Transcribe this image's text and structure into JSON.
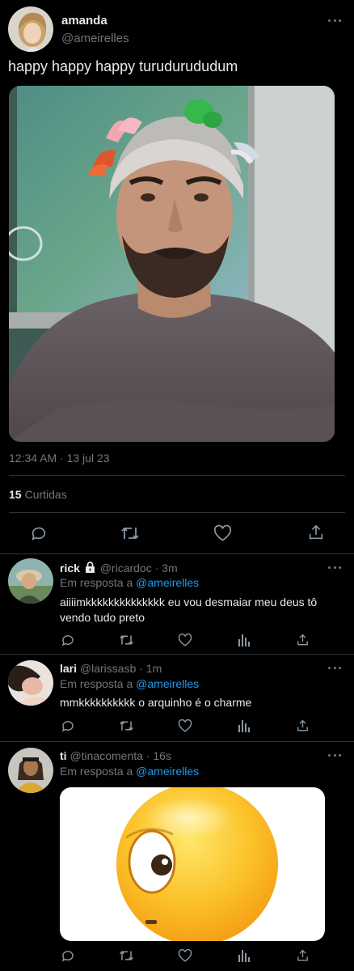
{
  "tweet": {
    "display_name": "amanda",
    "handle": "@ameirelles",
    "text": "happy happy happy turudurududum",
    "photo": "man-with-headband-photo",
    "timestamp": "12:34 AM · 13 jul 23",
    "likes_count": "15",
    "likes_label": "Curtidas"
  },
  "replies": [
    {
      "display_name": "rick",
      "locked": true,
      "handle": "@ricardoc",
      "time": "· 3m",
      "in_reply_prefix": "Em resposta a",
      "in_reply_to": "@ameirelles",
      "text": "aiiiimkkkkkkkkkkkkkk eu vou desmaiar meu deus tô vendo tudo preto"
    },
    {
      "display_name": "lari",
      "handle": "@larissasb",
      "time": "· 1m",
      "in_reply_prefix": "Em resposta a",
      "in_reply_to": "@ameirelles",
      "text": "mmkkkkkkkkkk o arquinho é o charme"
    },
    {
      "display_name": "ti",
      "handle": "@tinacomenta",
      "time": "· 16s",
      "in_reply_prefix": "Em resposta a",
      "in_reply_to": "@ameirelles",
      "media": "face-with-rolling-eye-emoji"
    }
  ],
  "icons": {
    "reply": "reply-icon",
    "retweet": "retweet-icon",
    "like": "heart-icon",
    "views": "views-icon",
    "share": "share-icon",
    "more": "more-icon",
    "lock": "lock-icon"
  },
  "colors": {
    "background": "#000000",
    "text": "#e7e9ea",
    "muted": "#71767b",
    "link": "#1d9bf0",
    "divider": "#2f3336"
  }
}
